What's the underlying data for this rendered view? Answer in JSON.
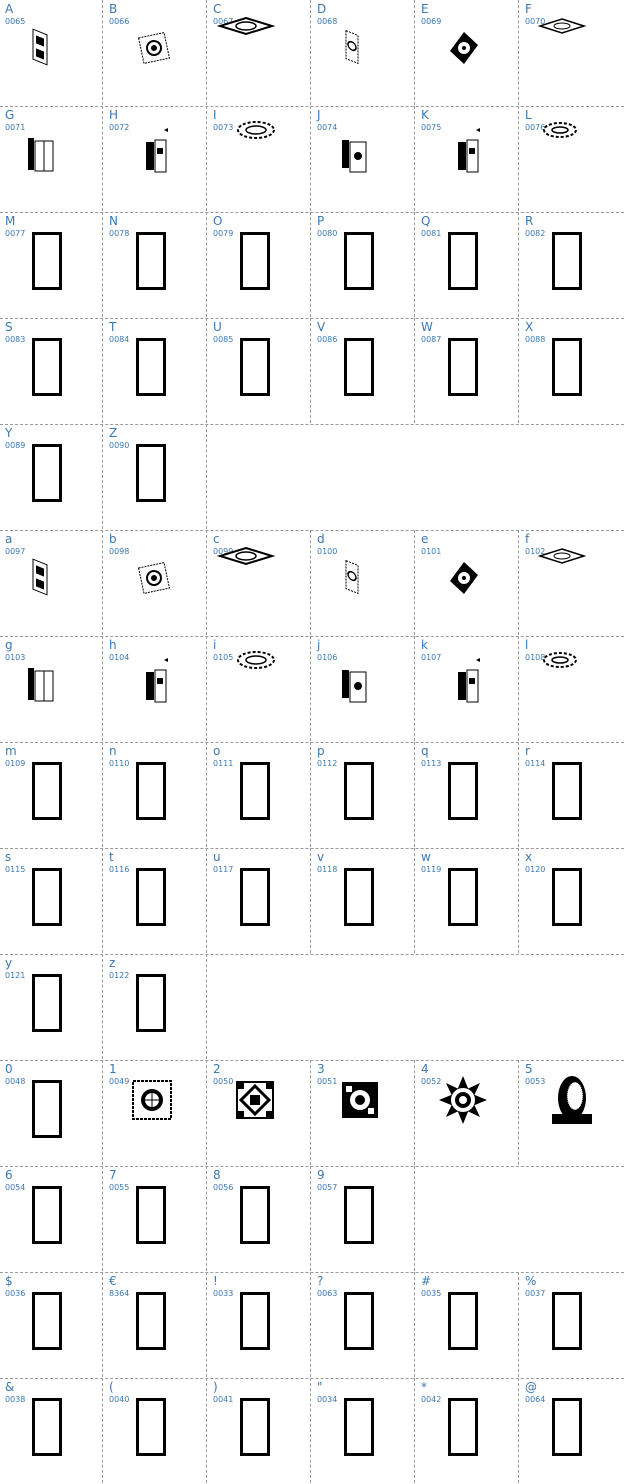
{
  "rows": [
    {
      "cells": [
        {
          "char": "A",
          "code": "0065",
          "glyph": "tilted-panel"
        },
        {
          "char": "B",
          "code": "0066",
          "glyph": "ornate-square"
        },
        {
          "char": "C",
          "code": "0067",
          "glyph": "flat-diamond"
        },
        {
          "char": "D",
          "code": "0068",
          "glyph": "tilted-panel-light"
        },
        {
          "char": "E",
          "code": "0069",
          "glyph": "diamond-panel"
        },
        {
          "char": "F",
          "code": "0070",
          "glyph": "flat-diamond-small"
        }
      ]
    },
    {
      "cells": [
        {
          "char": "G",
          "code": "0071",
          "glyph": "open-box"
        },
        {
          "char": "H",
          "code": "0072",
          "glyph": "open-box-dark"
        },
        {
          "char": "I",
          "code": "0073",
          "glyph": "sun-wheel"
        },
        {
          "char": "J",
          "code": "0074",
          "glyph": "open-box-alt"
        },
        {
          "char": "K",
          "code": "0075",
          "glyph": "open-box-dark"
        },
        {
          "char": "L",
          "code": "0076",
          "glyph": "sun-wheel-small"
        }
      ]
    },
    {
      "cells": [
        {
          "char": "M",
          "code": "0077",
          "glyph": "missing"
        },
        {
          "char": "N",
          "code": "0078",
          "glyph": "missing"
        },
        {
          "char": "O",
          "code": "0079",
          "glyph": "missing"
        },
        {
          "char": "P",
          "code": "0080",
          "glyph": "missing"
        },
        {
          "char": "Q",
          "code": "0081",
          "glyph": "missing"
        },
        {
          "char": "R",
          "code": "0082",
          "glyph": "missing"
        }
      ]
    },
    {
      "cells": [
        {
          "char": "S",
          "code": "0083",
          "glyph": "missing"
        },
        {
          "char": "T",
          "code": "0084",
          "glyph": "missing"
        },
        {
          "char": "U",
          "code": "0085",
          "glyph": "missing"
        },
        {
          "char": "V",
          "code": "0086",
          "glyph": "missing"
        },
        {
          "char": "W",
          "code": "0087",
          "glyph": "missing"
        },
        {
          "char": "X",
          "code": "0088",
          "glyph": "missing"
        }
      ]
    },
    {
      "cells": [
        {
          "char": "Y",
          "code": "0089",
          "glyph": "missing"
        },
        {
          "char": "Z",
          "code": "0090",
          "glyph": "missing"
        }
      ]
    },
    {
      "cells": [
        {
          "char": "a",
          "code": "0097",
          "glyph": "tilted-panel"
        },
        {
          "char": "b",
          "code": "0098",
          "glyph": "ornate-square"
        },
        {
          "char": "c",
          "code": "0099",
          "glyph": "flat-diamond"
        },
        {
          "char": "d",
          "code": "0100",
          "glyph": "tilted-panel-light"
        },
        {
          "char": "e",
          "code": "0101",
          "glyph": "diamond-panel"
        },
        {
          "char": "f",
          "code": "0102",
          "glyph": "flat-diamond-small"
        }
      ]
    },
    {
      "cells": [
        {
          "char": "g",
          "code": "0103",
          "glyph": "open-box"
        },
        {
          "char": "h",
          "code": "0104",
          "glyph": "open-box-dark"
        },
        {
          "char": "i",
          "code": "0105",
          "glyph": "sun-wheel"
        },
        {
          "char": "j",
          "code": "0106",
          "glyph": "open-box-alt"
        },
        {
          "char": "k",
          "code": "0107",
          "glyph": "open-box-dark"
        },
        {
          "char": "l",
          "code": "0108",
          "glyph": "sun-wheel-small"
        }
      ]
    },
    {
      "cells": [
        {
          "char": "m",
          "code": "0109",
          "glyph": "missing"
        },
        {
          "char": "n",
          "code": "0110",
          "glyph": "missing"
        },
        {
          "char": "o",
          "code": "0111",
          "glyph": "missing"
        },
        {
          "char": "p",
          "code": "0112",
          "glyph": "missing"
        },
        {
          "char": "q",
          "code": "0113",
          "glyph": "missing"
        },
        {
          "char": "r",
          "code": "0114",
          "glyph": "missing"
        }
      ]
    },
    {
      "cells": [
        {
          "char": "s",
          "code": "0115",
          "glyph": "missing"
        },
        {
          "char": "t",
          "code": "0116",
          "glyph": "missing"
        },
        {
          "char": "u",
          "code": "0117",
          "glyph": "missing"
        },
        {
          "char": "v",
          "code": "0118",
          "glyph": "missing"
        },
        {
          "char": "w",
          "code": "0119",
          "glyph": "missing"
        },
        {
          "char": "x",
          "code": "0120",
          "glyph": "missing"
        }
      ]
    },
    {
      "cells": [
        {
          "char": "y",
          "code": "0121",
          "glyph": "missing"
        },
        {
          "char": "z",
          "code": "0122",
          "glyph": "missing"
        }
      ]
    },
    {
      "cells": [
        {
          "char": "0",
          "code": "0048",
          "glyph": "missing"
        },
        {
          "char": "1",
          "code": "0049",
          "glyph": "sun-tile"
        },
        {
          "char": "2",
          "code": "0050",
          "glyph": "lattice-tile"
        },
        {
          "char": "3",
          "code": "0051",
          "glyph": "dark-tile"
        },
        {
          "char": "4",
          "code": "0052",
          "glyph": "star-sun"
        },
        {
          "char": "5",
          "code": "0053",
          "glyph": "portrait"
        }
      ]
    },
    {
      "cells": [
        {
          "char": "6",
          "code": "0054",
          "glyph": "missing"
        },
        {
          "char": "7",
          "code": "0055",
          "glyph": "missing"
        },
        {
          "char": "8",
          "code": "0056",
          "glyph": "missing"
        },
        {
          "char": "9",
          "code": "0057",
          "glyph": "missing"
        }
      ]
    },
    {
      "cells": [
        {
          "char": "$",
          "code": "0036",
          "glyph": "missing"
        },
        {
          "char": "€",
          "code": "8364",
          "glyph": "missing"
        },
        {
          "char": "!",
          "code": "0033",
          "glyph": "missing"
        },
        {
          "char": "?",
          "code": "0063",
          "glyph": "missing"
        },
        {
          "char": "#",
          "code": "0035",
          "glyph": "missing"
        },
        {
          "char": "%",
          "code": "0037",
          "glyph": "missing"
        }
      ]
    },
    {
      "cells": [
        {
          "char": "&",
          "code": "0038",
          "glyph": "missing"
        },
        {
          "char": "(",
          "code": "0040",
          "glyph": "missing"
        },
        {
          "char": ")",
          "code": "0041",
          "glyph": "missing"
        },
        {
          "char": "\"",
          "code": "0034",
          "glyph": "missing"
        },
        {
          "char": "*",
          "code": "0042",
          "glyph": "missing"
        },
        {
          "char": "@",
          "code": "0064",
          "glyph": "missing"
        }
      ]
    }
  ]
}
